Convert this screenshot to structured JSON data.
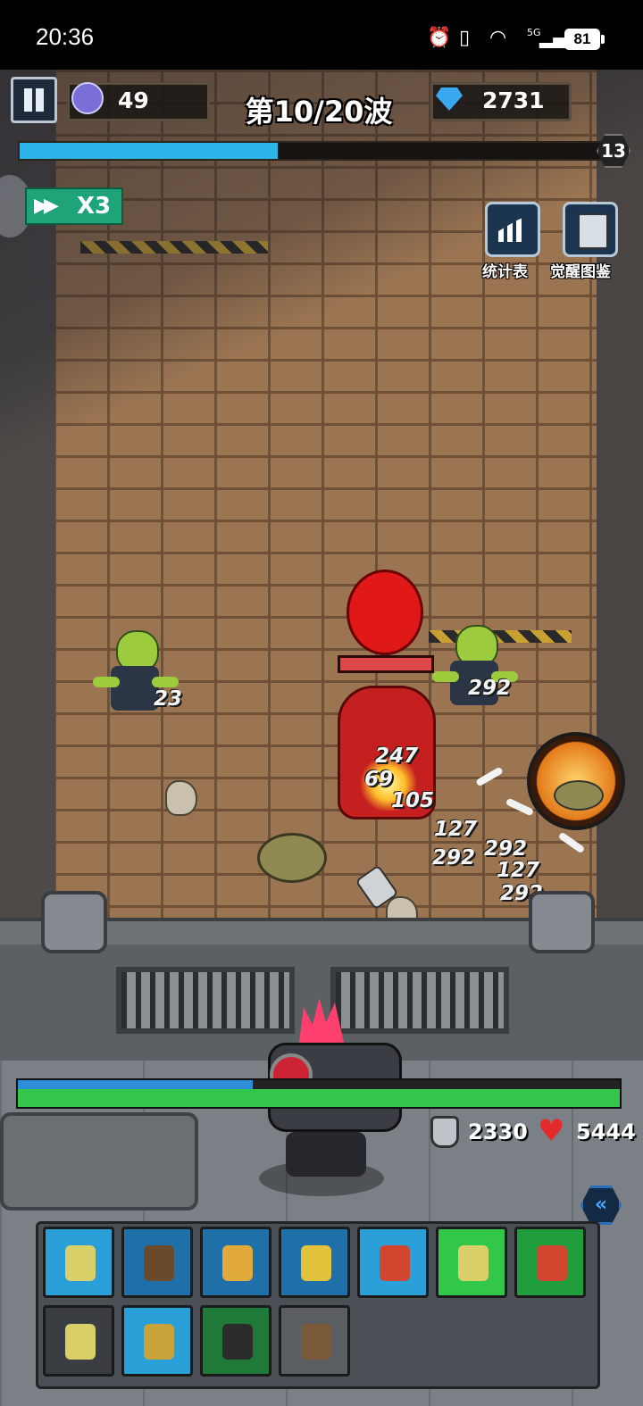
{
  "status_bar": {
    "time": "20:36",
    "battery": "81",
    "network": "5G"
  },
  "hud": {
    "gems": "49",
    "wave_text": "第10/20波",
    "diamonds": "2731",
    "wave_progress": 0.44,
    "level": "13",
    "speed_label": "X3"
  },
  "tools": [
    {
      "label": "统计表",
      "icon": "chart-icon"
    },
    {
      "label": "觉醒图鉴",
      "icon": "book-icon"
    }
  ],
  "damage_numbers": [
    "23",
    "292",
    "247",
    "69",
    "105",
    "127",
    "292",
    "292",
    "127",
    "292",
    "127"
  ],
  "player": {
    "shield_fraction": 0.39,
    "hp_fraction": 1.0,
    "armor": "2330",
    "hp": "5444"
  },
  "inventory": [
    {
      "item": "molotov-icon",
      "bg": "#2a9fd8"
    },
    {
      "item": "shotgun-icon",
      "bg": "#1f6fa8"
    },
    {
      "item": "orb-bomb-icon",
      "bg": "#1f6fa8"
    },
    {
      "item": "gauntlet-icon",
      "bg": "#1f6fa8"
    },
    {
      "item": "dynamite-icon",
      "bg": "#2a9fd8"
    },
    {
      "item": "molotov-icon",
      "bg": "#33c74a"
    },
    {
      "item": "dynamite-icon",
      "bg": "#1f9d3c"
    },
    {
      "item": "molotov-icon",
      "bg": "#3a3d42"
    },
    {
      "item": "landmine-icon",
      "bg": "#2a9fd8"
    },
    {
      "item": "glove-icon",
      "bg": "#1f7a3a"
    },
    {
      "item": "rifle-icon",
      "bg": "#5a5d62"
    }
  ]
}
